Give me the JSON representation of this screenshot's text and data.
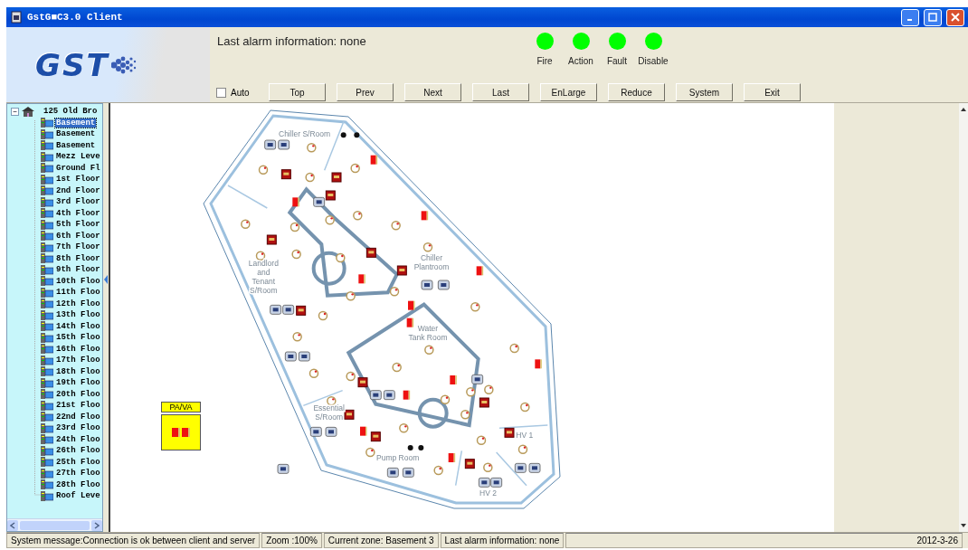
{
  "window": {
    "title": "GstG■C3.0 Client"
  },
  "logo": {
    "text": "GST"
  },
  "header": {
    "alarm_text": "Last alarm information: none"
  },
  "indicators": [
    {
      "label": "Fire",
      "color": "#00ff00"
    },
    {
      "label": "Action",
      "color": "#00ff00"
    },
    {
      "label": "Fault",
      "color": "#00ff00"
    },
    {
      "label": "Disable",
      "color": "#00ff00"
    }
  ],
  "auto_checkbox": {
    "label": "Auto",
    "checked": false
  },
  "buttons": [
    "Top",
    "Prev",
    "Next",
    "Last",
    "EnLarge",
    "Reduce",
    "System",
    "Exit"
  ],
  "tree": {
    "label": "125 Old Bro",
    "expanded": true,
    "children": [
      {
        "label": "Basement",
        "selected": true
      },
      {
        "label": "Basement",
        "selected": false
      },
      {
        "label": "Basement",
        "selected": false
      },
      {
        "label": "Mezz Leve",
        "selected": false
      },
      {
        "label": "Ground Fl",
        "selected": false
      },
      {
        "label": "1st Floor",
        "selected": false
      },
      {
        "label": "2nd Floor",
        "selected": false
      },
      {
        "label": "3rd Floor",
        "selected": false
      },
      {
        "label": "4th Floor",
        "selected": false
      },
      {
        "label": "5th Floor",
        "selected": false
      },
      {
        "label": "6th Floor",
        "selected": false
      },
      {
        "label": "7th Floor",
        "selected": false
      },
      {
        "label": "8th Floor",
        "selected": false
      },
      {
        "label": "9th Floor",
        "selected": false
      },
      {
        "label": "10th Floo",
        "selected": false
      },
      {
        "label": "11th Floo",
        "selected": false
      },
      {
        "label": "12th Floo",
        "selected": false
      },
      {
        "label": "13th Floo",
        "selected": false
      },
      {
        "label": "14th Floo",
        "selected": false
      },
      {
        "label": "15th Floo",
        "selected": false
      },
      {
        "label": "16th Floo",
        "selected": false
      },
      {
        "label": "17th Floo",
        "selected": false
      },
      {
        "label": "18th Floo",
        "selected": false
      },
      {
        "label": "19th Floo",
        "selected": false
      },
      {
        "label": "20th Floo",
        "selected": false
      },
      {
        "label": "21st Floo",
        "selected": false
      },
      {
        "label": "22nd Floo",
        "selected": false
      },
      {
        "label": "23rd Floo",
        "selected": false
      },
      {
        "label": "24th Floo",
        "selected": false
      },
      {
        "label": "26th Floo",
        "selected": false
      },
      {
        "label": "25th Floo",
        "selected": false
      },
      {
        "label": "27th Floo",
        "selected": false
      },
      {
        "label": "28th Floo",
        "selected": false
      },
      {
        "label": "Roof Leve",
        "selected": false
      }
    ]
  },
  "floor_plan": {
    "rooms": [
      {
        "lines": [
          "Chiller S/Room"
        ]
      },
      {
        "lines": [
          "Landlord",
          "and",
          "Tenant",
          "S/Room"
        ]
      },
      {
        "lines": [
          "Chiller",
          "Plantroom"
        ]
      },
      {
        "lines": [
          "Water",
          "Tank Room"
        ]
      },
      {
        "lines": [
          "Essential",
          "S/Room"
        ]
      },
      {
        "lines": [
          "Pump Room"
        ]
      },
      {
        "lines": [
          "HV 1"
        ]
      },
      {
        "lines": [
          "HV 2"
        ]
      }
    ],
    "panel": {
      "title": "PA/VA"
    }
  },
  "status_bar": [
    "System message:Connection is ok between client and server",
    "Zoom :100%",
    "Current zone: Basement 3",
    "Last alarm information: none",
    "2012-3-26"
  ]
}
